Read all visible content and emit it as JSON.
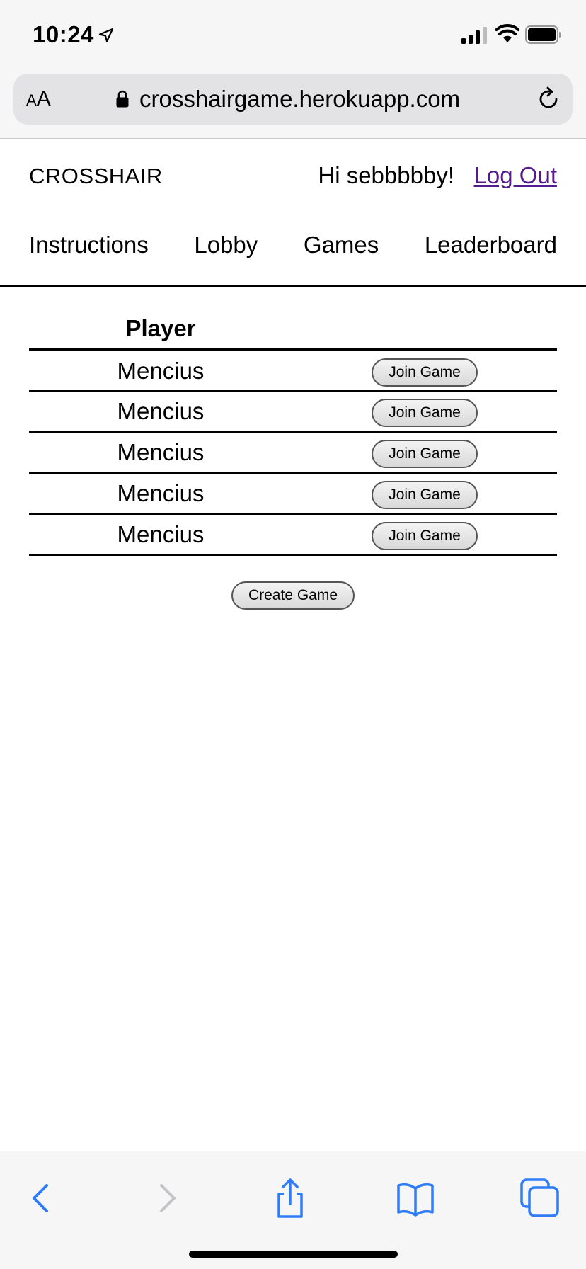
{
  "status_bar": {
    "time": "10:24"
  },
  "browser": {
    "text_size_label_small": "A",
    "text_size_label_large": "A",
    "url": "crosshairgame.herokuapp.com"
  },
  "header": {
    "brand": "CROSSHAIR",
    "greeting": "Hi sebbbbby!",
    "logout_label": "Log Out",
    "nav": [
      "Instructions",
      "Lobby",
      "Games",
      "Leaderboard"
    ]
  },
  "lobby": {
    "column_player": "Player",
    "rows": [
      {
        "player": "Mencius",
        "action": "Join Game"
      },
      {
        "player": "Mencius",
        "action": "Join Game"
      },
      {
        "player": "Mencius",
        "action": "Join Game"
      },
      {
        "player": "Mencius",
        "action": "Join Game"
      },
      {
        "player": "Mencius",
        "action": "Join Game"
      }
    ],
    "create_label": "Create Game"
  },
  "colors": {
    "link_visited": "#551a8b",
    "ios_blue": "#2f7cf6",
    "ios_disabled": "#c4c4c8"
  },
  "toolbar_icons": [
    "back-icon",
    "forward-icon",
    "share-icon",
    "bookmarks-icon",
    "tabs-icon"
  ]
}
